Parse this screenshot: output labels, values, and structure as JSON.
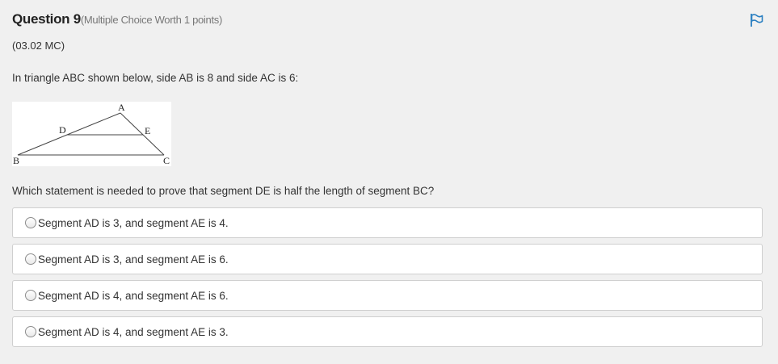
{
  "question": {
    "title": "Question 9",
    "worth": "(Multiple Choice Worth 1 points)",
    "code": "(03.02 MC)",
    "stem": "In triangle ABC shown below, side AB is 8 and side AC is 6:",
    "prompt": "Which statement is needed to prove that segment DE is half the length of segment BC?"
  },
  "figure": {
    "labels": {
      "A": "A",
      "B": "B",
      "C": "C",
      "D": "D",
      "E": "E"
    }
  },
  "options": [
    "Segment AD is 3, and segment AE is 4.",
    "Segment AD is 3, and segment AE is 6.",
    "Segment AD is 4, and segment AE is 6.",
    "Segment AD is 4, and segment AE is 3."
  ],
  "icons": {
    "flag": "flag-icon",
    "radio": "radio-button-icon"
  },
  "colors": {
    "flag_blue": "#2a7fc1",
    "background": "#f0f0f0",
    "option_border": "#cfcfcf"
  }
}
